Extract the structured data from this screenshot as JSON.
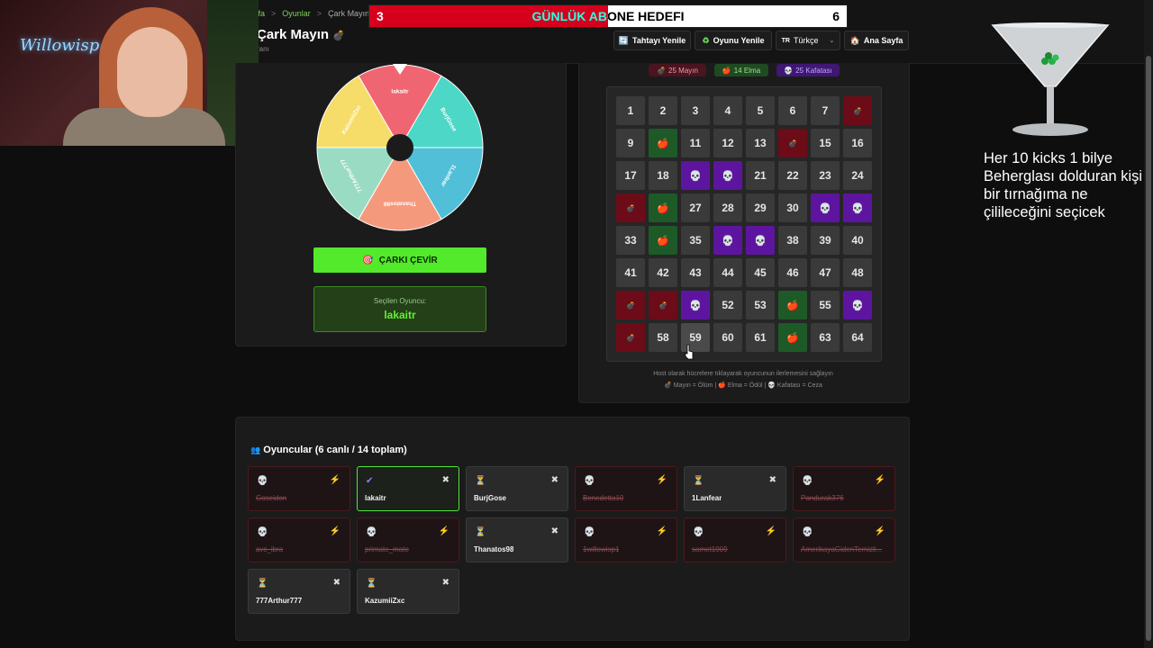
{
  "breadcrumb": {
    "items": [
      "yfa",
      "Oyunlar",
      "Çark Mayın"
    ]
  },
  "page": {
    "title": "Çark Mayın",
    "title_icon": "💣",
    "subtitle": "ranı"
  },
  "nav": [
    {
      "label": "Tahtayı Yenile",
      "icon": "🔄"
    },
    {
      "label": "Oyunu Yenile",
      "icon": "♻"
    },
    {
      "label": "Türkçe",
      "icon": "TR"
    },
    {
      "label": "Ana Sayfa",
      "icon": "🏠"
    }
  ],
  "goal": {
    "title": "GÜNLÜK ABONE HEDEFI",
    "current": "3",
    "target": "6",
    "progress": 0.5,
    "color": "#d6001c"
  },
  "wheel": {
    "segments": [
      {
        "label": "lakaitr",
        "color": "#ef6672"
      },
      {
        "label": "BurjGose",
        "color": "#4dd7c7"
      },
      {
        "label": "1Lanfear",
        "color": "#52bfd8"
      },
      {
        "label": "Thanatos98",
        "color": "#f5997c"
      },
      {
        "label": "777Arthur777",
        "color": "#9adbc4"
      },
      {
        "label": "KazumiiZxc",
        "color": "#f6dd6a"
      }
    ]
  },
  "spin_button": {
    "label": "ÇARKI ÇEVİR",
    "icon": "🎯"
  },
  "selected": {
    "label": "Seçilen Oyuncu:",
    "value": "lakaitr"
  },
  "stats": [
    {
      "label": "25 Mayın",
      "icon": "💣",
      "bg": "#4a1420",
      "fg": "#f19aa6"
    },
    {
      "label": "14 Elma",
      "icon": "🍎",
      "bg": "#1f4a22",
      "fg": "#9fe08c"
    },
    {
      "label": "25 Kafatası",
      "icon": "💀",
      "bg": "#3e1872",
      "fg": "#c6a3ff"
    }
  ],
  "board": {
    "cells": [
      {
        "t": "n",
        "v": "1"
      },
      {
        "t": "n",
        "v": "2"
      },
      {
        "t": "n",
        "v": "3"
      },
      {
        "t": "n",
        "v": "4"
      },
      {
        "t": "n",
        "v": "5"
      },
      {
        "t": "n",
        "v": "6"
      },
      {
        "t": "n",
        "v": "7"
      },
      {
        "t": "mine",
        "v": "💣"
      },
      {
        "t": "n",
        "v": "9"
      },
      {
        "t": "apple",
        "v": "🍎"
      },
      {
        "t": "n",
        "v": "11"
      },
      {
        "t": "n",
        "v": "12"
      },
      {
        "t": "n",
        "v": "13"
      },
      {
        "t": "mine",
        "v": "💣"
      },
      {
        "t": "n",
        "v": "15"
      },
      {
        "t": "n",
        "v": "16"
      },
      {
        "t": "n",
        "v": "17"
      },
      {
        "t": "n",
        "v": "18"
      },
      {
        "t": "skull",
        "v": "💀"
      },
      {
        "t": "skull",
        "v": "💀"
      },
      {
        "t": "n",
        "v": "21"
      },
      {
        "t": "n",
        "v": "22"
      },
      {
        "t": "n",
        "v": "23"
      },
      {
        "t": "n",
        "v": "24"
      },
      {
        "t": "mine",
        "v": "💣"
      },
      {
        "t": "apple",
        "v": "🍎"
      },
      {
        "t": "n",
        "v": "27"
      },
      {
        "t": "n",
        "v": "28"
      },
      {
        "t": "n",
        "v": "29"
      },
      {
        "t": "n",
        "v": "30"
      },
      {
        "t": "skull",
        "v": "💀"
      },
      {
        "t": "skull",
        "v": "💀"
      },
      {
        "t": "n",
        "v": "33"
      },
      {
        "t": "apple",
        "v": "🍎"
      },
      {
        "t": "n",
        "v": "35"
      },
      {
        "t": "skull",
        "v": "💀"
      },
      {
        "t": "skull",
        "v": "💀"
      },
      {
        "t": "n",
        "v": "38"
      },
      {
        "t": "n",
        "v": "39"
      },
      {
        "t": "n",
        "v": "40"
      },
      {
        "t": "n",
        "v": "41"
      },
      {
        "t": "n",
        "v": "42"
      },
      {
        "t": "n",
        "v": "43"
      },
      {
        "t": "n",
        "v": "44"
      },
      {
        "t": "n",
        "v": "45"
      },
      {
        "t": "n",
        "v": "46"
      },
      {
        "t": "n",
        "v": "47"
      },
      {
        "t": "n",
        "v": "48"
      },
      {
        "t": "mine",
        "v": "💣"
      },
      {
        "t": "mine",
        "v": "💣"
      },
      {
        "t": "skull",
        "v": "💀"
      },
      {
        "t": "n",
        "v": "52"
      },
      {
        "t": "n",
        "v": "53"
      },
      {
        "t": "apple",
        "v": "🍎"
      },
      {
        "t": "n",
        "v": "55"
      },
      {
        "t": "skull",
        "v": "💀"
      },
      {
        "t": "mine",
        "v": "💣"
      },
      {
        "t": "n",
        "v": "58"
      },
      {
        "t": "n",
        "v": "59"
      },
      {
        "t": "n",
        "v": "60"
      },
      {
        "t": "n",
        "v": "61"
      },
      {
        "t": "apple",
        "v": "🍎"
      },
      {
        "t": "n",
        "v": "63"
      },
      {
        "t": "n",
        "v": "64"
      }
    ]
  },
  "hint": {
    "line1": "Host olarak hücrelere tıklayarak oyuncunun ilerlemesini sağlayın",
    "line2": "💣 Mayın = Ölüm | 🍎 Elma = Ödül | 💀 Kafatası = Ceza"
  },
  "players": {
    "title": "Oyuncular (6 canlı / 14 toplam)",
    "title_icon": "👥",
    "list": [
      {
        "name": "Goseidon",
        "state": "dead",
        "status_icon": "💀",
        "action_icon": "⚡"
      },
      {
        "name": "lakaitr",
        "state": "sel",
        "status_icon": "✔",
        "action_icon": "✖"
      },
      {
        "name": "BurjGose",
        "state": "alive",
        "status_icon": "⏳",
        "action_icon": "✖"
      },
      {
        "name": "Benedetta10",
        "state": "dead",
        "status_icon": "💀",
        "action_icon": "⚡"
      },
      {
        "name": "1Lanfear",
        "state": "alive",
        "status_icon": "⏳",
        "action_icon": "✖"
      },
      {
        "name": "Pandurak376",
        "state": "dead",
        "status_icon": "💀",
        "action_icon": "⚡"
      },
      {
        "name": "avc_ibra",
        "state": "dead",
        "status_icon": "💀",
        "action_icon": "⚡"
      },
      {
        "name": "primate_mate",
        "state": "dead",
        "status_icon": "💀",
        "action_icon": "⚡"
      },
      {
        "name": "Thanatos98",
        "state": "alive",
        "status_icon": "⏳",
        "action_icon": "✖"
      },
      {
        "name": "1willowisp1",
        "state": "dead",
        "status_icon": "💀",
        "action_icon": "⚡"
      },
      {
        "name": "samet1909",
        "state": "dead",
        "status_icon": "💀",
        "action_icon": "⚡"
      },
      {
        "name": "AmerikayaGidenTemizli...",
        "state": "dead",
        "status_icon": "💀",
        "action_icon": "⚡"
      },
      {
        "name": "777Arthur777",
        "state": "alive",
        "status_icon": "⏳",
        "action_icon": "✖"
      },
      {
        "name": "KazumiiZxc",
        "state": "alive",
        "status_icon": "⏳",
        "action_icon": "✖"
      }
    ]
  },
  "overlay": {
    "text": "Her 10 kicks 1 bilye Beherglası dolduran kişi bir tırnağıma ne çilileceğini seçicek"
  },
  "webcam": {
    "neon_text": "Willowisp"
  }
}
